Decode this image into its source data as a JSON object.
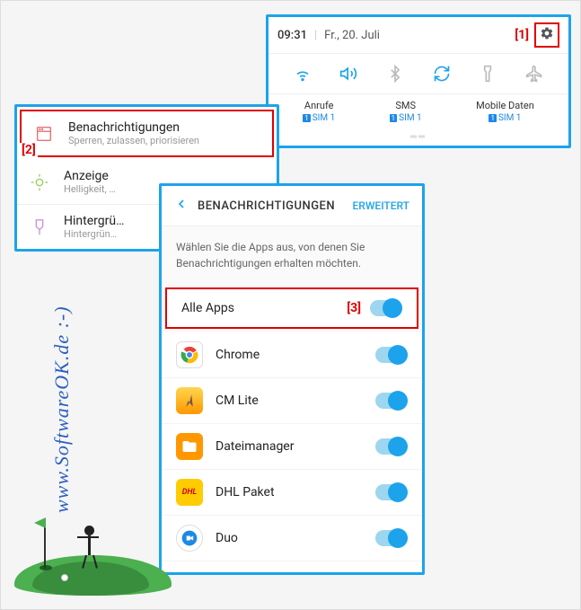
{
  "markers": {
    "m1": "[1]",
    "m2": "[2]",
    "m3": "[3]"
  },
  "quicksettings": {
    "time": "09:31",
    "date": "Fr., 20. Juli",
    "tiles": [
      {
        "title": "Anrufe",
        "sub": "SIM 1"
      },
      {
        "title": "SMS",
        "sub": "SIM 1"
      },
      {
        "title": "Mobile Daten",
        "sub": "SIM 1"
      }
    ]
  },
  "settings": {
    "items": [
      {
        "title": "Benachrichtigungen",
        "sub": "Sperren, zulassen, priorisieren",
        "highlighted": true
      },
      {
        "title": "Anzeige",
        "sub": "Helligkeit, …"
      },
      {
        "title": "Hintergrü…",
        "sub": "Hintergrün…"
      }
    ]
  },
  "notif": {
    "title": "BENACHRICHTIGUNGEN",
    "advanced": "ERWEITERT",
    "desc": "Wählen Sie die Apps aus, von denen Sie Benachrichtigungen erhalten möchten.",
    "all_label": "Alle Apps",
    "apps": [
      {
        "name": "Chrome"
      },
      {
        "name": "CM Lite"
      },
      {
        "name": "Dateimanager"
      },
      {
        "name": "DHL Paket"
      },
      {
        "name": "Duo"
      }
    ]
  },
  "watermark": "www.SoftwareOK.de :-)"
}
